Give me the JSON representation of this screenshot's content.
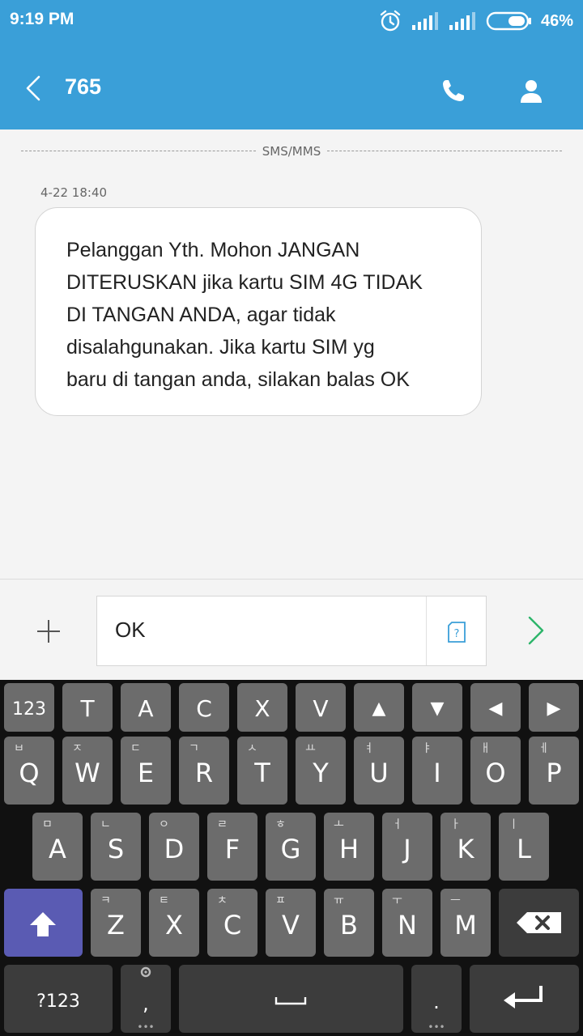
{
  "status": {
    "time": "9:19 PM",
    "battery": "46%"
  },
  "header": {
    "title": "765"
  },
  "conversation": {
    "divider_label": "SMS/MMS",
    "message": {
      "timestamp": "4-22 18:40",
      "lines": [
        "Pelanggan Yth. Mohon JANGAN",
        "DITERUSKAN jika kartu SIM 4G TIDAK",
        "DI TANGAN ANDA, agar tidak",
        "disalahgunakan. Jika kartu SIM yg",
        "baru di tangan anda, silakan balas OK"
      ]
    }
  },
  "compose": {
    "text": "OK"
  },
  "keyboard": {
    "toprow": [
      "123",
      "T",
      "A",
      "C",
      "X",
      "V",
      "▲",
      "▼",
      "◀",
      "▶"
    ],
    "row1": [
      {
        "key": "Q",
        "hint": "ㅂ"
      },
      {
        "key": "W",
        "hint": "ㅈ"
      },
      {
        "key": "E",
        "hint": "ㄷ"
      },
      {
        "key": "R",
        "hint": "ㄱ"
      },
      {
        "key": "T",
        "hint": "ㅅ"
      },
      {
        "key": "Y",
        "hint": "ㅛ"
      },
      {
        "key": "U",
        "hint": "ㅕ"
      },
      {
        "key": "I",
        "hint": "ㅑ"
      },
      {
        "key": "O",
        "hint": "ㅐ"
      },
      {
        "key": "P",
        "hint": "ㅔ"
      }
    ],
    "row2": [
      {
        "key": "A",
        "hint": "ㅁ"
      },
      {
        "key": "S",
        "hint": "ㄴ"
      },
      {
        "key": "D",
        "hint": "ㅇ"
      },
      {
        "key": "F",
        "hint": "ㄹ"
      },
      {
        "key": "G",
        "hint": "ㅎ"
      },
      {
        "key": "H",
        "hint": "ㅗ"
      },
      {
        "key": "J",
        "hint": "ㅓ"
      },
      {
        "key": "K",
        "hint": "ㅏ"
      },
      {
        "key": "L",
        "hint": "ㅣ"
      }
    ],
    "row3": [
      {
        "key": "Z",
        "hint": "ㅋ"
      },
      {
        "key": "X",
        "hint": "ㅌ"
      },
      {
        "key": "C",
        "hint": "ㅊ"
      },
      {
        "key": "V",
        "hint": "ㅍ"
      },
      {
        "key": "B",
        "hint": "ㅠ"
      },
      {
        "key": "N",
        "hint": "ㅜ"
      },
      {
        "key": "M",
        "hint": "ㅡ"
      }
    ],
    "bottom": {
      "symbols": "?123",
      "comma": ",",
      "period": "."
    }
  }
}
